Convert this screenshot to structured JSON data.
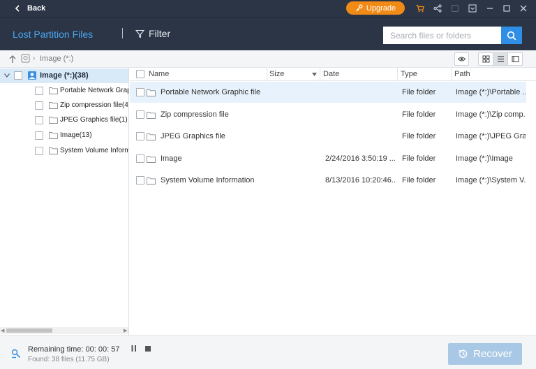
{
  "topbar": {
    "back_label": "Back",
    "upgrade_label": "Upgrade",
    "icons": [
      "cart-icon",
      "share-icon",
      "feedback-icon",
      "menu-icon",
      "minimize-icon",
      "maximize-icon",
      "close-icon"
    ]
  },
  "header": {
    "title": "Lost Partition Files",
    "filter_label": "Filter",
    "search_placeholder": "Search files or folders"
  },
  "pathbar": {
    "location": "Image (*:)"
  },
  "sidebar": {
    "root_label": "Image (*:)(38)",
    "items": [
      {
        "label": "Portable Network Graph"
      },
      {
        "label": "Zip compression file(4)"
      },
      {
        "label": "JPEG Graphics file(1)"
      },
      {
        "label": "Image(13)"
      },
      {
        "label": "System Volume Informa"
      }
    ]
  },
  "columns": {
    "name": "Name",
    "size": "Size",
    "date": "Date",
    "type": "Type",
    "path": "Path"
  },
  "files": [
    {
      "name": "Portable Network Graphic file",
      "size": "",
      "date": "",
      "type": "File folder",
      "path": "Image (*:)\\Portable ..."
    },
    {
      "name": "Zip compression file",
      "size": "",
      "date": "",
      "type": "File folder",
      "path": "Image (*:)\\Zip comp..."
    },
    {
      "name": "JPEG Graphics file",
      "size": "",
      "date": "",
      "type": "File folder",
      "path": "Image (*:)\\JPEG Gra..."
    },
    {
      "name": "Image",
      "size": "",
      "date": "2/24/2016 3:50:19 ...",
      "type": "File folder",
      "path": "Image (*:)\\Image"
    },
    {
      "name": "System Volume Information",
      "size": "",
      "date": "8/13/2016 10:20:46...",
      "type": "File folder",
      "path": "Image (*:)\\System V..."
    }
  ],
  "status": {
    "remaining": "Remaining time: 00: 00: 57",
    "found": "Found: 38 files (11.75 GB)"
  },
  "recover_label": "Recover",
  "colors": {
    "header_bg": "#2b3546",
    "accent": "#4aa7f2",
    "upgrade": "#f28a16",
    "search_button": "#2f8ee6",
    "recover_disabled": "#a9c8e5"
  }
}
